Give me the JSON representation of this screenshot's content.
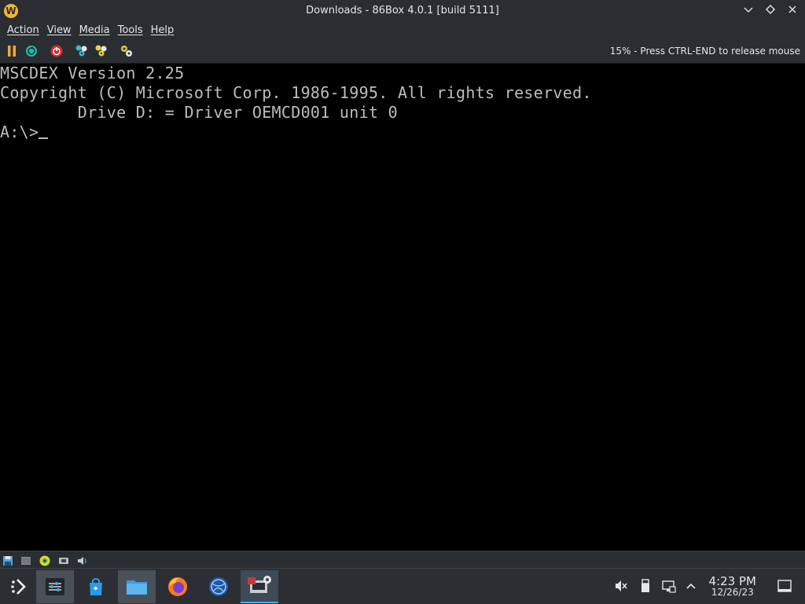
{
  "window": {
    "title": "Downloads - 86Box 4.0.1 [build 5111]",
    "app_icon_letter": "W",
    "controls": [
      "minimize",
      "maximize",
      "close"
    ]
  },
  "menu": {
    "items": [
      "Action",
      "View",
      "Media",
      "Tools",
      "Help"
    ]
  },
  "toolbar": {
    "buttons": [
      "pause-icon",
      "reset-icon",
      "power-icon",
      "ctrl-alt-del-icon",
      "ctrl-alt-esc-icon",
      "settings-icon"
    ],
    "status": "15% - Press CTRL-END to release mouse"
  },
  "console": {
    "lines": [
      "MSCDEX Version 2.25",
      "Copyright (C) Microsoft Corp. 1986-1995. All rights reserved.",
      "        Drive D: = Driver OEMCD001 unit 0",
      "",
      "A:\\>"
    ]
  },
  "statusbar": {
    "icons": [
      "floppy-icon",
      "hard-disk-icon",
      "cdrom-icon",
      "network-icon",
      "sound-icon"
    ]
  },
  "taskbar": {
    "apps": [
      "launcher-icon",
      "system-settings-icon",
      "discover-store-icon",
      "file-manager-icon",
      "firefox-icon",
      "browser-globe-icon",
      "86box-icon"
    ],
    "tray": [
      "volume-muted-icon",
      "usb-drive-icon",
      "network-icon",
      "expand-tray-icon"
    ],
    "clock_time": "4:23 PM",
    "clock_date": "12/26/23"
  },
  "colors": {
    "chrome": "#2a2e32",
    "console_text": "#bdbdbd",
    "accent": "#3daee9"
  }
}
